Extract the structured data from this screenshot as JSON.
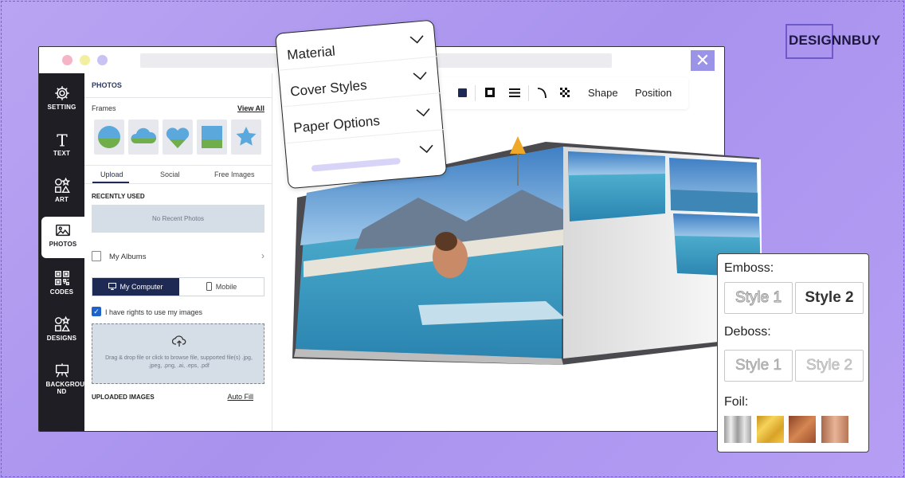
{
  "brand": {
    "name": "DESIGNNBUY"
  },
  "window": {
    "close_glyph": "✕"
  },
  "rail": {
    "items": [
      {
        "label": "SETTING",
        "icon": "gear-icon"
      },
      {
        "label": "TEXT",
        "icon": "text-icon"
      },
      {
        "label": "ART",
        "icon": "shapes-icon"
      },
      {
        "label": "PHOTOS",
        "icon": "image-icon",
        "active": true
      },
      {
        "label": "CODES",
        "icon": "qr-icon"
      },
      {
        "label": "DESIGNS",
        "icon": "designs-icon"
      },
      {
        "label": "BACKGROU ND",
        "icon": "easel-icon"
      }
    ]
  },
  "panel": {
    "title": "PHOTOS",
    "frames_label": "Frames",
    "view_all": "View All",
    "tabs": [
      "Upload",
      "Social",
      "Free Images"
    ],
    "recently_used": "RECENTLY USED",
    "no_recent": "No Recent Photos",
    "my_albums": "My Albums",
    "source_tabs": [
      "My Computer",
      "Mobile"
    ],
    "rights_label": "I have rights to use my images",
    "drop_text": "Drag & drop file or click to browse file, supported file(s) .jpg, .jpeg, .png, .ai, .eps, .pdf",
    "uploaded_images": "UPLOADED IMAGES",
    "auto_fill": "Auto Fill"
  },
  "toolbar": {
    "shape": "Shape",
    "position": "Position"
  },
  "dropdown": {
    "items": [
      "Material",
      "Cover Styles",
      "Paper Options",
      ""
    ]
  },
  "finishes": {
    "emboss_label": "Emboss:",
    "emboss_styles": [
      "Style 1",
      "Style 2"
    ],
    "deboss_label": "Deboss:",
    "deboss_styles": [
      "Style 1",
      "Style 2"
    ],
    "foil_label": "Foil:",
    "foil_colors": [
      "#c4c4c4",
      "#e6b830",
      "#b9673c",
      "#c98a6c"
    ]
  }
}
